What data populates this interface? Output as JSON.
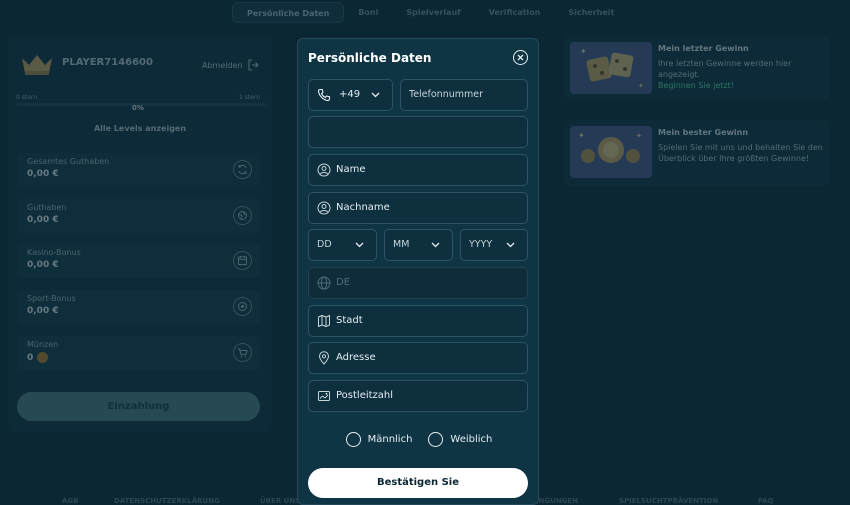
{
  "tabs": [
    "Persönliche Daten",
    "Boni",
    "Spielverlauf",
    "Verification",
    "Sicherheit"
  ],
  "profile": {
    "player_name": "PLAYER7146600",
    "logout_label": "Abmelden",
    "level_left": "0 stern",
    "level_right": "1 stern",
    "progress_text": "0%",
    "progress_fraction": 0,
    "levels_link": "Alle Levels anzeigen",
    "stats": [
      {
        "label": "Gesamtes Guthaben",
        "value": "0,00 €",
        "icon": "refresh-icon"
      },
      {
        "label": "Guthaben",
        "value": "0,00 €",
        "icon": "globe-icon"
      },
      {
        "label": "Kasino-Bonus",
        "value": "0,00 €",
        "icon": "calendar-icon"
      },
      {
        "label": "Sport-Bonus",
        "value": "0,00 €",
        "icon": "ball-icon"
      },
      {
        "label": "Münzen",
        "value": "0",
        "icon": "cart-icon"
      }
    ],
    "deposit_label": "Einzahlung"
  },
  "wins": {
    "last": {
      "title": "Mein letzter Gewinn",
      "text": "Ihre letzten Gewinne werden hier angezeigt.",
      "link": "Beginnen Sie jetzt!"
    },
    "best": {
      "title": "Mein bester Gewinn",
      "text": "Spielen Sie mit uns und behalten Sie den Überblick über Ihre größten Gewinne!"
    }
  },
  "footer": [
    "AGB",
    "DATENSCHUTZERKLÄRUNG",
    "ÜBER UNS",
    "BEDINGUNGEN",
    "SPIELSUCHTPRÄVENTION",
    "FAQ"
  ],
  "modal": {
    "title": "Persönliche Daten",
    "country_code": "+49",
    "phone_placeholder": "Telefonnummer",
    "name_placeholder": "Name",
    "surname_placeholder": "Nachname",
    "day_placeholder": "DD",
    "month_placeholder": "MM",
    "year_placeholder": "YYYY",
    "country_value": "DE",
    "city_placeholder": "Stadt",
    "address_placeholder": "Adresse",
    "zip_placeholder": "Postleitzahl",
    "gender_male": "Männlich",
    "gender_female": "Weiblich",
    "submit_label": "Bestätigen Sie"
  },
  "colors": {
    "background": "#0b2733",
    "accent": "#5de0a4",
    "submit": "#ffffff"
  }
}
